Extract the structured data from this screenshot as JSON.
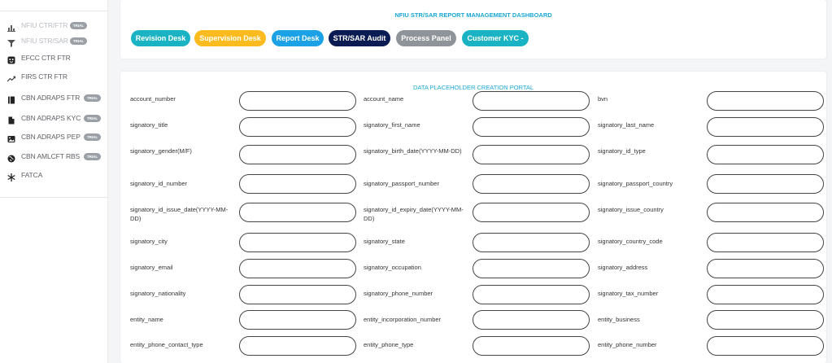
{
  "sidebar": {
    "items": [
      {
        "label": "NFIU CTR/FTR",
        "trial": "TRIAL",
        "icon": "bar-chart-icon"
      },
      {
        "label": "NFIU STR/SAR",
        "trial": "TRIAL",
        "icon": "filter-icon"
      },
      {
        "label": "EFCC CTR FTR",
        "trial": "",
        "icon": "face-icon"
      },
      {
        "label": "FIRS CTR FTR",
        "trial": "",
        "icon": "trend-line-icon"
      },
      {
        "label": "CBN ADRAPS FTR",
        "trial": "TRIAL",
        "icon": "book-icon"
      },
      {
        "label": "CBN ADRAPS KYC",
        "trial": "TRIAL",
        "icon": "file-icon"
      },
      {
        "label": "CBN ADRAPS PEP",
        "trial": "TRIAL",
        "icon": "image-icon"
      },
      {
        "label": "CBN AMLCFT RBS",
        "trial": "TRIAL",
        "icon": "globe-icon"
      },
      {
        "label": "FATCA",
        "trial": "",
        "icon": "snowflake-icon"
      }
    ]
  },
  "dashboard": {
    "title": "NFIU STR/SAR REPORT MANAGEMENT DASHBOARD",
    "buttons": [
      {
        "label": "Revision Desk",
        "color": "#1ab3c4"
      },
      {
        "label": "Supervision Desk",
        "color": "#fbbb1f"
      },
      {
        "label": "Report Desk",
        "color": "#1aa1e6"
      },
      {
        "label": "STR/SAR Audit",
        "color": "#0a1a52"
      },
      {
        "label": "Process Panel",
        "color": "#8f949a"
      },
      {
        "label": "Customer KYC -",
        "color": "#1ab3c4"
      }
    ]
  },
  "form": {
    "title": "DATA PLACEHOLDER CREATION PORTAL",
    "fields": [
      "account_number",
      "account_name",
      "bvn",
      "signatory_title",
      "signatory_first_name",
      "signatory_last_name",
      "signatory_gender(M/F)",
      "signatory_birth_date(YYYY-MM-DD)",
      "signatory_id_type",
      "signatory_id_number",
      "signatory_passport_number",
      "signatory_passport_country",
      "signatory_id_issue_date(YYYY-MM-DD)",
      "signatory_id_expiry_date(YYYY-MM-DD)",
      "signatory_issue_country",
      "signatory_city",
      "signatory_state",
      "signatory_country_code",
      "signatory_email",
      "signatory_occupation",
      "signatory_address",
      "signatory_nationality",
      "signatory_phone_number",
      "signatory_tax_number",
      "entity_name",
      "entity_incorporation_number",
      "entity_business",
      "entity_phone_contact_type",
      "entity_phone_type",
      "entity_phone_number"
    ]
  }
}
